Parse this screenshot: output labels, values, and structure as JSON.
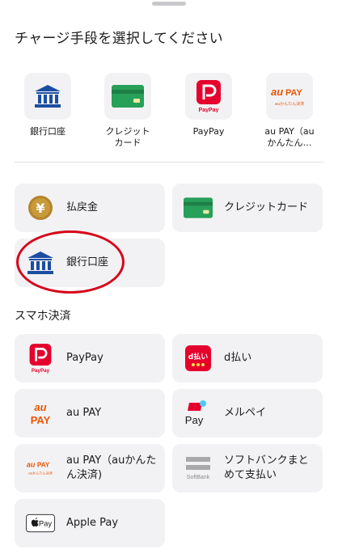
{
  "sheet": {
    "title": "チャージ手段を選択してください"
  },
  "quick_actions": [
    {
      "label": "銀行口座",
      "icon": "bank-icon"
    },
    {
      "label": "クレジット\nカード",
      "icon": "credit-card-icon"
    },
    {
      "label": "PayPay",
      "icon": "paypay-icon"
    },
    {
      "label": "au PAY（au\nかんたん…",
      "icon": "au-pay-icon"
    }
  ],
  "charge_methods": [
    {
      "label": "払戻金",
      "icon": "yen-coin-icon"
    },
    {
      "label": "クレジットカード",
      "icon": "credit-card-icon"
    },
    {
      "label": "銀行口座",
      "icon": "bank-icon"
    }
  ],
  "smartphone_section": {
    "title": "スマホ決済",
    "items": [
      {
        "label": "PayPay",
        "icon": "paypay-icon"
      },
      {
        "label": "d払い",
        "icon": "d-barai-icon"
      },
      {
        "label": "au PAY",
        "icon": "au-pay-icon"
      },
      {
        "label": "メルペイ",
        "icon": "merpay-icon"
      },
      {
        "label": "au PAY（auかんた\nん決済)",
        "icon": "au-pay-kantan-icon"
      },
      {
        "label": "ソフトバンクまと\nめて支払い",
        "icon": "softbank-icon"
      },
      {
        "label": "Apple Pay",
        "icon": "apple-pay-icon"
      }
    ]
  },
  "icon_text": {
    "paypay": "PayPay",
    "au_small": "auかんたん決済",
    "d_text": "d払い",
    "softbank": "SoftBank",
    "pay": "Pay",
    "apple_pay": "Pay",
    "yen": "¥",
    "au_pay_au": "au",
    "au_pay_pay": "PAY"
  },
  "colors": {
    "accent_red": "#e5022c",
    "bank_blue": "#1b4ea3",
    "card_green": "#27a05a",
    "coin_gold": "#b3842b",
    "au_orange": "#eb5505",
    "highlight_circle": "#d6061a"
  }
}
